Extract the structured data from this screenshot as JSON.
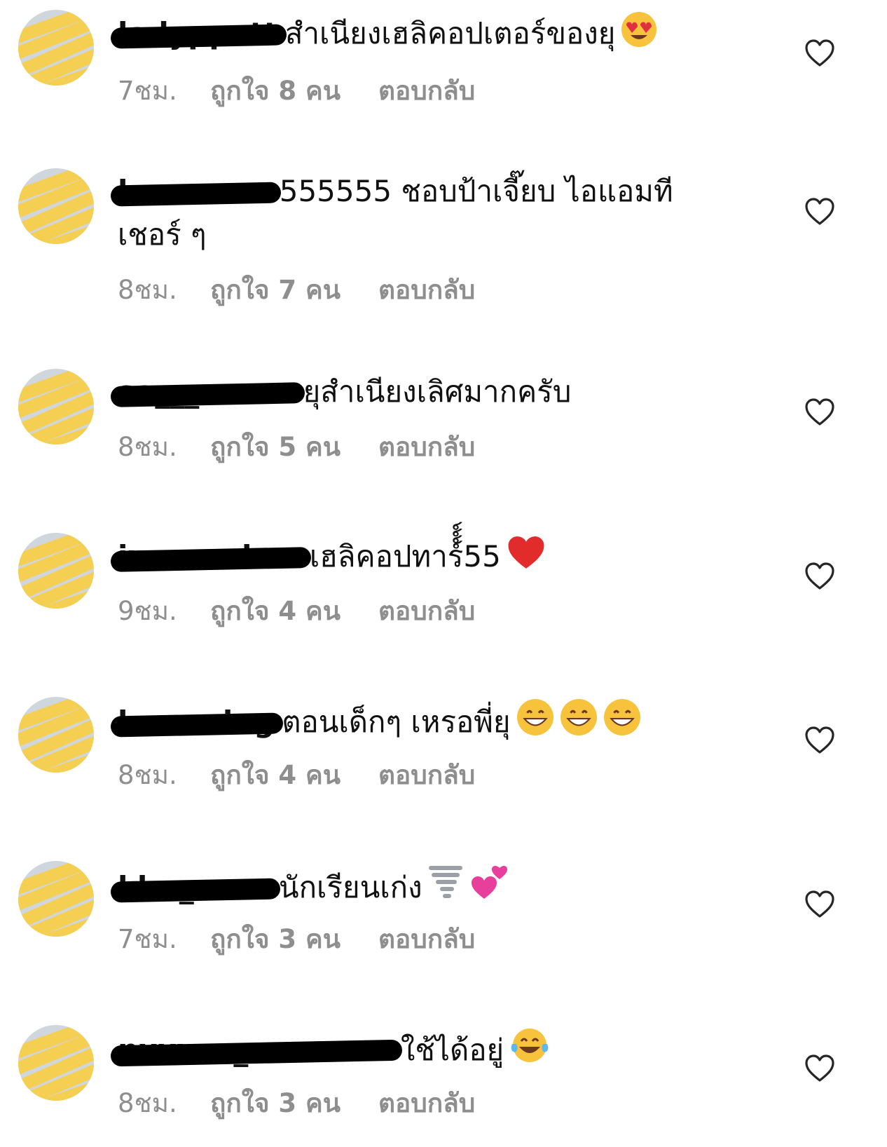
{
  "comments": [
    {
      "username": "ladyppatt",
      "text": "สำเนียงเฮลิคอปเตอร์ของยุ",
      "emojis": [
        "heart-eyes-emoji"
      ],
      "time": "7ชม.",
      "likes": "ถูกใจ 8 คน",
      "reply": "ตอบกลับ"
    },
    {
      "username": "lxxxxxxm",
      "text": "555555 ชอบป้าเจี๊ยบ ไอแอมทีเชอร์ ๆ",
      "emojis": [],
      "time": "8ชม.",
      "likes": "ถูกใจ 7 คน",
      "reply": "ตอบกลับ"
    },
    {
      "username": "sa___xxxxn",
      "text": "ยุสำเนียงเลิศมากครับ",
      "emojis": [],
      "time": "8ชม.",
      "likes": "ถูกใจ 5 คน",
      "reply": "ตอบกลับ"
    },
    {
      "username": "ixxxxxxhee",
      "text": "เฮลิคอปทาร์์์์55",
      "emojis": [
        "red-heart-emoji"
      ],
      "time": "9ชม.",
      "likes": "ถูกใจ 4 คน",
      "reply": "ตอบกลับ"
    },
    {
      "username": "lxxxxxing",
      "text": "ตอนเด็กๆ เหรอพี่ยุ",
      "emojis": [
        "grinning-emoji",
        "grinning-emoji",
        "grinning-emoji"
      ],
      "time": "8ชม.",
      "likes": "ถูกใจ 4 คน",
      "reply": "ตอบกลับ"
    },
    {
      "username": "khu_xxxn",
      "text": "นักเรียนเก่ง",
      "emojis": [
        "tornado-emoji",
        "two-hearts-emoji"
      ],
      "time": "7ชม.",
      "likes": "ถูกใจ 3 คน",
      "reply": "ตอบกลับ"
    },
    {
      "username": "nxxxxx_xxxxxam",
      "text": "ใช้ได้อยู่",
      "emojis": [
        "tears-of-joy-emoji"
      ],
      "time": "8ชม.",
      "likes": "ถูกใจ 3 คน",
      "reply": "ตอบกลับ"
    }
  ],
  "colors": {
    "meta_text": "#8e8e8e",
    "scribble": "#f5cf52",
    "redaction": "#000000"
  }
}
